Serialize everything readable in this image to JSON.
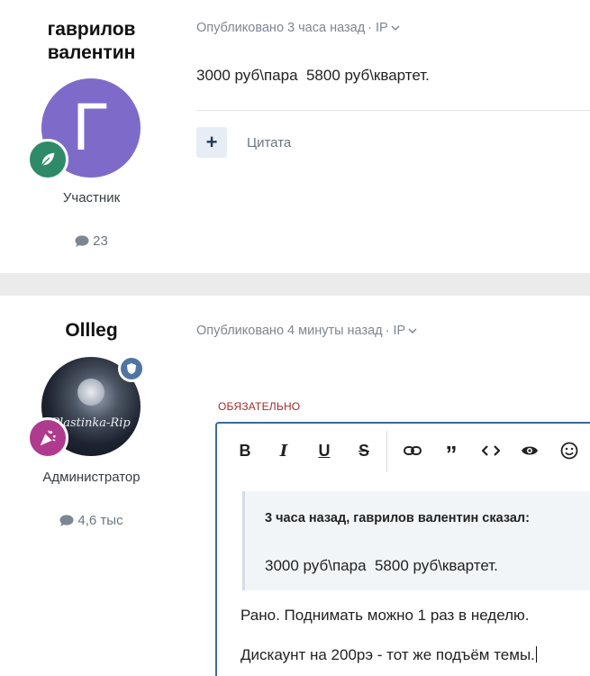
{
  "posts": [
    {
      "author": {
        "name_line1": "гаврилов",
        "name_line2": "валентин",
        "avatar_letter": "Г",
        "avatar_color": "#7e6bc9",
        "badge_color": "#2f8a6a",
        "group": "Участник",
        "post_count": "23"
      },
      "meta": {
        "published": "Опубликовано 3 часа назад",
        "ip": "· IP"
      },
      "content": "3000 руб\\пара  5800 руб\\квартет.",
      "actions": {
        "plus": "+",
        "quote": "Цитата"
      }
    },
    {
      "author": {
        "name": "Ollleg",
        "avatar_watermark": "Plastinka-Rip",
        "badge_color": "#b03a8e",
        "mod_badge_color": "#4f75a0",
        "group": "Администратор",
        "post_count": "4,6 тыс"
      },
      "meta": {
        "published": "Опубликовано 4 минуты назад",
        "ip": "· IP"
      }
    }
  ],
  "editor": {
    "required_label": "ОБЯЗАТЕЛЬНО",
    "toolbar": {
      "bold": "B",
      "italic": "I",
      "underline": "U",
      "strike": "S"
    },
    "quote": {
      "citation": "3 часа назад, гаврилов валентин сказал:",
      "text": "3000 руб\\пара  5800 руб\\квартет."
    },
    "lines": [
      "Рано. Поднимать можно 1 раз в неделю.",
      "Дискаунт на 200рэ - тот же подъём темы."
    ]
  }
}
